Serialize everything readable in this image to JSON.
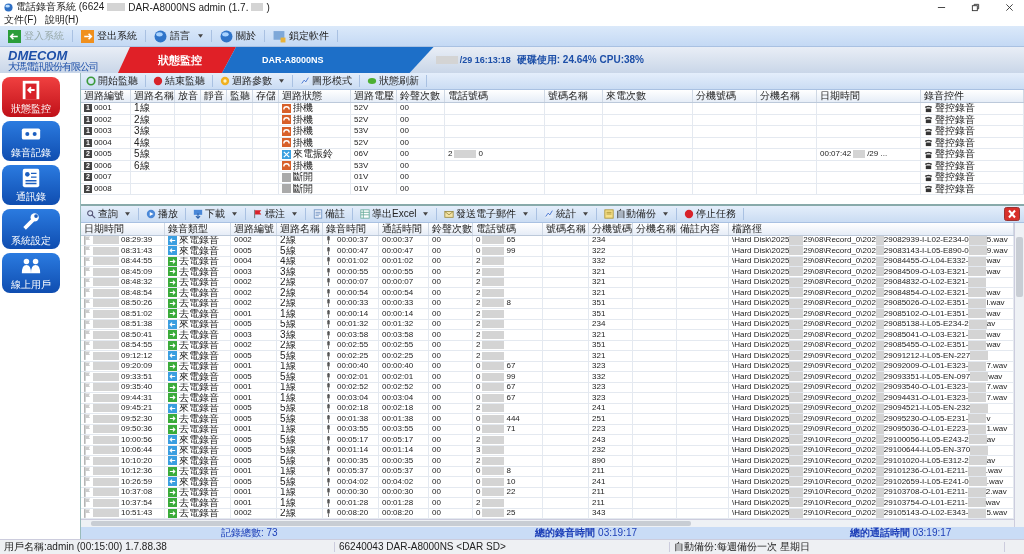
{
  "window": {
    "title_parts": [
      "電話錄音系統 (6624",
      "DAR-A8000NS admin (1.7.",
      ")"
    ]
  },
  "menu": [
    "文件(F)",
    "說明(H)"
  ],
  "toolbar": [
    {
      "label": "登入系統",
      "kind": "login",
      "disabled": true,
      "dropdown": false
    },
    {
      "label": "登出系統",
      "kind": "logout",
      "disabled": false,
      "dropdown": false
    },
    {
      "label": "語言",
      "kind": "language",
      "disabled": false,
      "dropdown": true
    },
    {
      "label": "關於",
      "kind": "about",
      "disabled": false,
      "dropdown": false
    },
    {
      "label": "鎖定軟件",
      "kind": "lock",
      "disabled": false,
      "dropdown": false
    }
  ],
  "banner": {
    "logo": "DMECOM",
    "company": "大瑪電訊股份有限公司",
    "tab": "狀態監控",
    "device": "DAR-A8000NS",
    "clock": "/29 16:13:18",
    "usage": "硬碟使用: 24.64% CPU:38%"
  },
  "nav": [
    {
      "label": "狀態監控",
      "kind": "monitor",
      "selected": true
    },
    {
      "label": "錄音記錄",
      "kind": "records",
      "selected": false
    },
    {
      "label": "通訊錄",
      "kind": "contacts",
      "selected": false
    },
    {
      "label": "系統設定",
      "kind": "settings",
      "selected": false
    },
    {
      "label": "線上用戶",
      "kind": "users",
      "selected": false
    }
  ],
  "channel_toolbar": [
    {
      "label": "開始監聽",
      "kind": "start",
      "dropdown": false
    },
    {
      "label": "結束監聽",
      "kind": "stop",
      "dropdown": false
    },
    {
      "label": "迴路參數",
      "kind": "params",
      "dropdown": true
    },
    {
      "label": "圖形模式",
      "kind": "graph",
      "dropdown": false
    },
    {
      "label": "狀態刷新",
      "kind": "refresh",
      "dropdown": false
    }
  ],
  "channel_table": {
    "columns": [
      "迴路編號",
      "迴路名稱",
      "放音",
      "靜音",
      "監聽",
      "存儲",
      "迴路狀態",
      "迴路電壓",
      "鈴聲次數",
      "電話號碼",
      "號碼名稱",
      "來電次數",
      "分機號碼",
      "分機名稱",
      "日期時間",
      "錄音控件"
    ],
    "rows": [
      {
        "badge": "1",
        "id": "0001",
        "name": "1線",
        "kind": "onhook",
        "status": "掛機",
        "voltage": "52V",
        "rings": "00",
        "control": "聲控錄音"
      },
      {
        "badge": "1",
        "id": "0002",
        "name": "2線",
        "kind": "onhook",
        "status": "掛機",
        "voltage": "52V",
        "rings": "00",
        "control": "聲控錄音"
      },
      {
        "badge": "1",
        "id": "0003",
        "name": "3線",
        "kind": "onhook",
        "status": "掛機",
        "voltage": "53V",
        "rings": "00",
        "control": "聲控錄音"
      },
      {
        "badge": "1",
        "id": "0004",
        "name": "4線",
        "kind": "onhook",
        "status": "掛機",
        "voltage": "52V",
        "rings": "00",
        "control": "聲控錄音"
      },
      {
        "badge": "2",
        "id": "0005",
        "name": "5線",
        "kind": "ringing",
        "status": "來電振鈴",
        "voltage": "06V",
        "rings": "00",
        "phone": [
          "2",
          "0"
        ],
        "datetime": [
          "00:07:42",
          "/29 ..."
        ],
        "control": "聲控錄音"
      },
      {
        "badge": "2",
        "id": "0006",
        "name": "6線",
        "kind": "onhook",
        "status": "掛機",
        "voltage": "53V",
        "rings": "00",
        "control": "聲控錄音"
      },
      {
        "badge": "2",
        "id": "0007",
        "kind": "disconnected",
        "status": "斷開",
        "voltage": "01V",
        "rings": "00",
        "control": "聲控錄音"
      },
      {
        "badge": "2",
        "id": "0008",
        "kind": "disconnected",
        "status": "斷開",
        "voltage": "01V",
        "rings": "00",
        "control": "聲控錄音"
      }
    ]
  },
  "record_toolbar": [
    {
      "label": "查詢",
      "kind": "query",
      "dropdown": true
    },
    {
      "label": "播放",
      "kind": "play",
      "dropdown": false
    },
    {
      "label": "下載",
      "kind": "download",
      "dropdown": true
    },
    {
      "label": "標注",
      "kind": "mark",
      "dropdown": true
    },
    {
      "label": "備註",
      "kind": "note",
      "dropdown": false
    },
    {
      "label": "導出Excel",
      "kind": "excel",
      "dropdown": true
    },
    {
      "label": "發送電子郵件",
      "kind": "email",
      "dropdown": true
    },
    {
      "label": "統計",
      "kind": "stats",
      "dropdown": true
    },
    {
      "label": "自動備份",
      "kind": "backup",
      "dropdown": true
    },
    {
      "label": "停止任務",
      "kind": "stop",
      "dropdown": false
    }
  ],
  "record_table": {
    "columns": [
      "日期時間",
      "錄音類型",
      "迴路編號",
      "迴路名稱",
      "錄音時間",
      "通話時間",
      "鈴聲次數",
      "電話號碼",
      "號碼名稱",
      "分機號碼",
      "分機名稱",
      "備註內容",
      "檔路徑"
    ],
    "rows": [
      {
        "time": "08:29:39",
        "kind": "incoming",
        "type": "來電錄音",
        "loop": "0002",
        "name": "2線",
        "rec": "00:00:37",
        "call": "00:00:37",
        "rings": "00",
        "phone": [
          "0",
          "65"
        ],
        "ext": "234",
        "path": [
          "\\Hard Disk\\2025",
          "29\\08\\Record_0\\202",
          "29082939-I-L02-E234-0",
          "5.wav"
        ]
      },
      {
        "time": "08:31:43",
        "kind": "incoming",
        "type": "來電錄音",
        "loop": "0005",
        "name": "5線",
        "rec": "00:00:47",
        "call": "00:00:47",
        "rings": "00",
        "phone": [
          "0",
          "99"
        ],
        "ext": "322",
        "path": [
          "\\Hard Disk\\2025",
          "29\\08\\Record_0\\202",
          "29083143-I-L05-E890-0",
          "9.wav"
        ]
      },
      {
        "time": "08:44:55",
        "kind": "outgoing",
        "type": "去電錄音",
        "loop": "0004",
        "name": "4線",
        "rec": "00:01:02",
        "call": "00:01:02",
        "rings": "00",
        "phone": [
          "2"
        ],
        "ext": "332",
        "path": [
          "\\Hard Disk\\2025",
          "29\\08\\Record_0\\202",
          "29084455-O-L04-E332-",
          "wav"
        ]
      },
      {
        "time": "08:45:09",
        "kind": "outgoing",
        "type": "去電錄音",
        "loop": "0003",
        "name": "3線",
        "rec": "00:00:55",
        "call": "00:00:55",
        "rings": "00",
        "phone": [
          "2"
        ],
        "ext": "321",
        "path": [
          "\\Hard Disk\\2025",
          "29\\08\\Record_0\\202",
          "29084509-O-L03-E321-",
          "wav"
        ]
      },
      {
        "time": "08:48:32",
        "kind": "outgoing",
        "type": "去電錄音",
        "loop": "0002",
        "name": "2線",
        "rec": "00:00:07",
        "call": "00:00:07",
        "rings": "00",
        "phone": [
          "2"
        ],
        "ext": "321",
        "path": [
          "\\Hard Disk\\2025",
          "29\\08\\Record_0\\202",
          "29084832-O-L02-E321-"
        ]
      },
      {
        "time": "08:48:54",
        "kind": "outgoing",
        "type": "去電錄音",
        "loop": "0002",
        "name": "2線",
        "rec": "00:00:54",
        "call": "00:00:54",
        "rings": "00",
        "phone": [
          "2"
        ],
        "ext": "321",
        "path": [
          "\\Hard Disk\\2025",
          "29\\08\\Record_0\\202",
          "29084854-O-L02-E321-",
          "wav"
        ]
      },
      {
        "time": "08:50:26",
        "kind": "outgoing",
        "type": "去電錄音",
        "loop": "0002",
        "name": "2線",
        "rec": "00:00:33",
        "call": "00:00:33",
        "rings": "00",
        "phone": [
          "2",
          "8"
        ],
        "ext": "351",
        "path": [
          "\\Hard Disk\\2025",
          "29\\08\\Record_0\\202",
          "29085026-O-L02-E351-",
          "l.wav"
        ]
      },
      {
        "time": "08:51:02",
        "kind": "outgoing",
        "type": "去電錄音",
        "loop": "0001",
        "name": "1線",
        "rec": "00:00:14",
        "call": "00:00:14",
        "rings": "00",
        "phone": [
          "2"
        ],
        "ext": "351",
        "path": [
          "\\Hard Disk\\2025",
          "29\\08\\Record_0\\202",
          "29085102-O-L01-E351-",
          "wav"
        ]
      },
      {
        "time": "08:51:38",
        "kind": "incoming",
        "type": "來電錄音",
        "loop": "0005",
        "name": "5線",
        "rec": "00:01:32",
        "call": "00:01:32",
        "rings": "00",
        "phone": [
          "2"
        ],
        "ext": "234",
        "path": [
          "\\Hard Disk\\2025",
          "29\\08\\Record_0\\202",
          "29085138-I-L05-E234-2",
          "av"
        ]
      },
      {
        "time": "08:50:41",
        "kind": "outgoing",
        "type": "去電錄音",
        "loop": "0003",
        "name": "3線",
        "rec": "00:03:58",
        "call": "00:03:58",
        "rings": "00",
        "phone": [
          "2"
        ],
        "ext": "321",
        "path": [
          "\\Hard Disk\\2025",
          "29\\08\\Record_0\\202",
          "29085041-O-L03-E321-",
          "wav"
        ]
      },
      {
        "time": "08:54:55",
        "kind": "outgoing",
        "type": "去電錄音",
        "loop": "0002",
        "name": "2線",
        "rec": "00:02:55",
        "call": "00:02:55",
        "rings": "00",
        "phone": [
          "2"
        ],
        "ext": "351",
        "path": [
          "\\Hard Disk\\2025",
          "29\\08\\Record_0\\202",
          "29085455-O-L02-E351-",
          "wav"
        ]
      },
      {
        "time": "09:12:12",
        "kind": "incoming",
        "type": "來電錄音",
        "loop": "0005",
        "name": "5線",
        "rec": "00:02:25",
        "call": "00:02:25",
        "rings": "00",
        "phone": [
          "2"
        ],
        "ext": "321",
        "path": [
          "\\Hard Disk\\2025",
          "29\\09\\Record_0\\202",
          "29091212-I-L05-EN-227"
        ]
      },
      {
        "time": "09:20:09",
        "kind": "outgoing",
        "type": "去電錄音",
        "loop": "0001",
        "name": "1線",
        "rec": "00:00:40",
        "call": "00:00:40",
        "rings": "00",
        "phone": [
          "0",
          "67"
        ],
        "ext": "323",
        "path": [
          "\\Hard Disk\\2025",
          "29\\09\\Record_0\\202",
          "29092009-O-L01-E323-",
          "7.wav"
        ]
      },
      {
        "time": "09:33:51",
        "kind": "incoming",
        "type": "來電錄音",
        "loop": "0005",
        "name": "5線",
        "rec": "00:02:01",
        "call": "00:02:01",
        "rings": "00",
        "phone": [
          "0",
          "99"
        ],
        "ext": "332",
        "path": [
          "\\Hard Disk\\2025",
          "29\\09\\Record_0\\202",
          "29093351-I-L05-EN-097",
          "wav"
        ]
      },
      {
        "time": "09:35:40",
        "kind": "outgoing",
        "type": "去電錄音",
        "loop": "0001",
        "name": "1線",
        "rec": "00:02:52",
        "call": "00:02:52",
        "rings": "00",
        "phone": [
          "0",
          "67"
        ],
        "ext": "323",
        "path": [
          "\\Hard Disk\\2025",
          "29\\09\\Record_0\\202",
          "29093540-O-L01-E323-",
          "7.wav"
        ]
      },
      {
        "time": "09:44:31",
        "kind": "outgoing",
        "type": "去電錄音",
        "loop": "0001",
        "name": "1線",
        "rec": "00:03:04",
        "call": "00:03:04",
        "rings": "00",
        "phone": [
          "0",
          "67"
        ],
        "ext": "323",
        "path": [
          "\\Hard Disk\\2025",
          "29\\09\\Record_0\\202",
          "29094431-O-L01-E323-",
          "7.wav"
        ]
      },
      {
        "time": "09:45:21",
        "kind": "incoming",
        "type": "來電錄音",
        "loop": "0005",
        "name": "5線",
        "rec": "00:02:18",
        "call": "00:02:18",
        "rings": "00",
        "phone": [
          "2"
        ],
        "ext": "241",
        "path": [
          "\\Hard Disk\\2025",
          "29\\09\\Record_0\\202",
          "29094521-I-L05-EN-232"
        ]
      },
      {
        "time": "09:52:30",
        "kind": "outgoing",
        "type": "去電錄音",
        "loop": "0005",
        "name": "5線",
        "rec": "00:01:38",
        "call": "00:01:38",
        "rings": "00",
        "phone": [
          "0",
          "444"
        ],
        "ext": "251",
        "path": [
          "\\Hard Disk\\2025",
          "29\\09\\Record_0\\202",
          "29095230-O-L05-E231-",
          "v"
        ]
      },
      {
        "time": "09:50:36",
        "kind": "outgoing",
        "type": "去電錄音",
        "loop": "0001",
        "name": "1線",
        "rec": "00:03:55",
        "call": "00:03:55",
        "rings": "00",
        "phone": [
          "0",
          "71"
        ],
        "ext": "223",
        "path": [
          "\\Hard Disk\\2025",
          "29\\09\\Record_0\\202",
          "29095036-O-L01-E223-",
          "1.wav"
        ]
      },
      {
        "time": "10:00:56",
        "kind": "incoming",
        "type": "來電錄音",
        "loop": "0005",
        "name": "5線",
        "rec": "00:05:17",
        "call": "00:05:17",
        "rings": "00",
        "phone": [
          "2"
        ],
        "ext": "243",
        "path": [
          "\\Hard Disk\\2025",
          "29\\10\\Record_0\\202",
          "29100056-I-L05-E243-2",
          "av"
        ]
      },
      {
        "time": "10:06:44",
        "kind": "incoming",
        "type": "來電錄音",
        "loop": "0005",
        "name": "5線",
        "rec": "00:01:14",
        "call": "00:01:14",
        "rings": "00",
        "phone": [
          "3"
        ],
        "ext": "232",
        "path": [
          "\\Hard Disk\\2025",
          "29\\10\\Record_0\\202",
          "29100644-I-L05-EN-370"
        ]
      },
      {
        "time": "10:10:20",
        "kind": "incoming",
        "type": "來電錄音",
        "loop": "0005",
        "name": "5線",
        "rec": "00:00:35",
        "call": "00:00:35",
        "rings": "00",
        "phone": [
          "2"
        ],
        "ext": "890",
        "path": [
          "\\Hard Disk\\2025",
          "29\\10\\Record_0\\202",
          "29101020-I-L05-E312-2",
          "av"
        ]
      },
      {
        "time": "10:12:36",
        "kind": "outgoing",
        "type": "去電錄音",
        "loop": "0001",
        "name": "1線",
        "rec": "00:05:37",
        "call": "00:05:37",
        "rings": "00",
        "phone": [
          "0",
          "8"
        ],
        "ext": "211",
        "path": [
          "\\Hard Disk\\2025",
          "29\\10\\Record_0\\202",
          "29101236-O-L01-E211-",
          ".wav"
        ]
      },
      {
        "time": "10:26:59",
        "kind": "incoming",
        "type": "來電錄音",
        "loop": "0005",
        "name": "5線",
        "rec": "00:04:02",
        "call": "00:04:02",
        "rings": "00",
        "phone": [
          "0",
          "10"
        ],
        "ext": "241",
        "path": [
          "\\Hard Disk\\2025",
          "29\\10\\Record_0\\202",
          "29102659-I-L05-E241-0",
          ".wav"
        ]
      },
      {
        "time": "10:37:08",
        "kind": "outgoing",
        "type": "去電錄音",
        "loop": "0001",
        "name": "1線",
        "rec": "00:00:30",
        "call": "00:00:30",
        "rings": "00",
        "phone": [
          "0",
          "22"
        ],
        "ext": "211",
        "path": [
          "\\Hard Disk\\2025",
          "29\\10\\Record_0\\202",
          "29103708-O-L01-E211-",
          "2.wav"
        ]
      },
      {
        "time": "10:37:54",
        "kind": "outgoing",
        "type": "去電錄音",
        "loop": "0001",
        "name": "1線",
        "rec": "00:01:28",
        "call": "00:01:28",
        "rings": "00",
        "phone": [
          "2"
        ],
        "ext": "211",
        "path": [
          "\\Hard Disk\\2025",
          "29\\10\\Record_0\\202",
          "29103754-O-L01-E211-",
          "wav"
        ]
      },
      {
        "time": "10:51:43",
        "kind": "outgoing",
        "type": "去電錄音",
        "loop": "0002",
        "name": "2線",
        "rec": "00:08:20",
        "call": "00:08:20",
        "rings": "00",
        "phone": [
          "0",
          "25"
        ],
        "ext": "343",
        "path": [
          "\\Hard Disk\\2025",
          "29\\10\\Record_0\\202",
          "29105143-O-L02-E343-",
          "5.wav"
        ]
      }
    ]
  },
  "totals": {
    "count": "記錄總數: 73",
    "rec_label": "總的錄音時間",
    "rec_value": "03:19:17",
    "call_label": "總的通話時間",
    "call_value": "03:19:17"
  },
  "status_bar": [
    "用戶名稱:admin (00:15:00) 1.7.88.38",
    "66240043 DAR-A8000NS <DAR SD>",
    "自動備份:每週備份一次 星期日"
  ]
}
